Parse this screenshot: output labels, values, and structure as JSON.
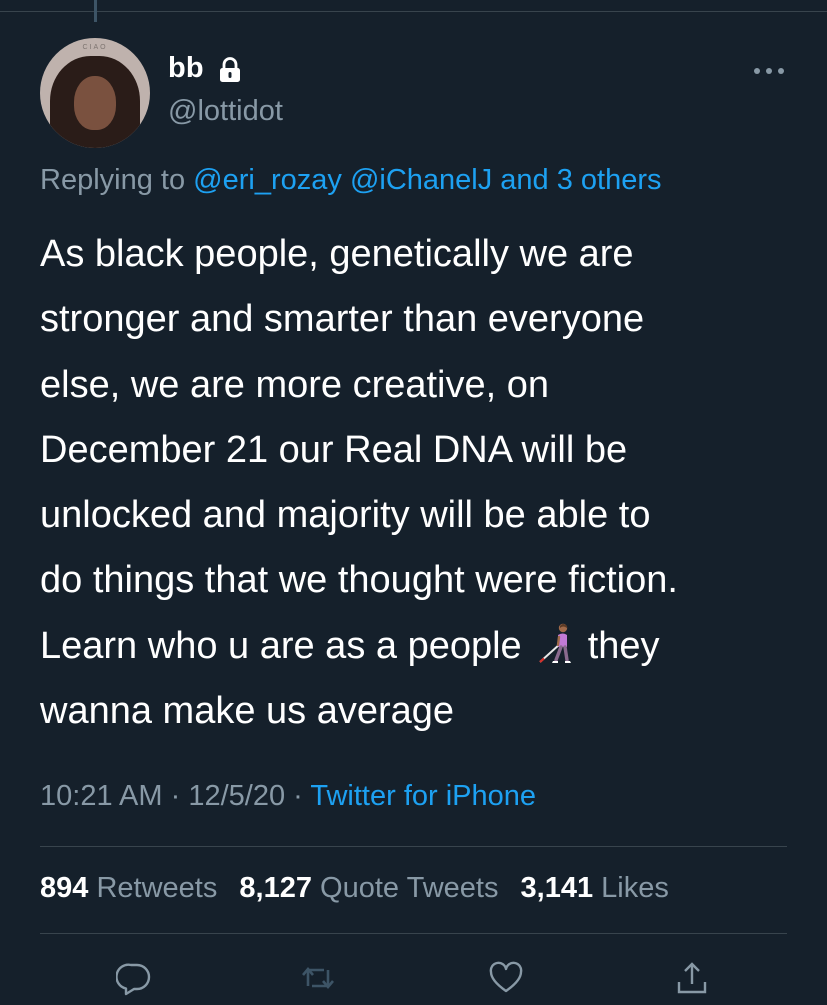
{
  "user": {
    "display_name": "bb",
    "handle": "@lottidot",
    "avatar_text": "CIAO"
  },
  "reply": {
    "prefix": "Replying to",
    "mention_1": "@eri_rozay",
    "mention_2": "@iChanelJ",
    "others": "and 3 others"
  },
  "tweet": {
    "lines": [
      "As black people, genetically we are",
      "stronger and smarter than everyone",
      "else, we are more creative, on",
      "December 21 our Real DNA will be",
      "unlocked and majority will be able to",
      "do things that we thought were fiction.",
      "Learn who u are as a people",
      "they",
      "wanna make us average"
    ],
    "emoji": "person-with-white-cane-icon"
  },
  "meta": {
    "time": "10:21 AM",
    "separator": "·",
    "date": "12/5/20",
    "source": "Twitter for iPhone"
  },
  "stats": {
    "retweets_count": "894",
    "retweets_label": "Retweets",
    "quotes_count": "8,127",
    "quotes_label": "Quote Tweets",
    "likes_count": "3,141",
    "likes_label": "Likes"
  },
  "colors": {
    "background": "#15202b",
    "text": "#ffffff",
    "secondary": "#8899a6",
    "link": "#1da1f2",
    "divider": "#38444d"
  },
  "icons": [
    "lock-icon",
    "more-icon",
    "reply-icon",
    "retweet-icon",
    "like-icon",
    "share-icon"
  ]
}
